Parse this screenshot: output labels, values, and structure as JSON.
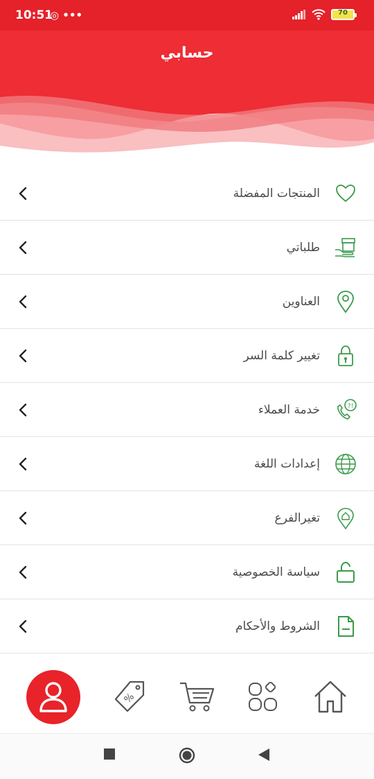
{
  "status_bar": {
    "time": "10:51",
    "left_icons": "◎ •••",
    "battery": "70"
  },
  "header": {
    "title": "حسابي",
    "accent_color": "#e8232a"
  },
  "menu": {
    "items": [
      {
        "label": "المنتجات المفضلة",
        "icon": "heart-icon"
      },
      {
        "label": "طلباتي",
        "icon": "box-hand-icon"
      },
      {
        "label": "العناوين",
        "icon": "location-pin-icon"
      },
      {
        "label": "تغيير كلمة السر",
        "icon": "lock-icon"
      },
      {
        "label": "خدمة العملاء",
        "icon": "phone-support-icon"
      },
      {
        "label": "إعدادات اللغة",
        "icon": "globe-icon"
      },
      {
        "label": "تغيرالفرع",
        "icon": "home-pin-icon"
      },
      {
        "label": "سياسة الخصوصية",
        "icon": "unlock-icon"
      },
      {
        "label": "الشروط والأحكام",
        "icon": "document-icon"
      }
    ],
    "icon_color": "#3a9a4a"
  },
  "bottom_nav": {
    "items": [
      "home-icon",
      "categories-icon",
      "cart-icon",
      "offers-tag-icon",
      "account-icon"
    ],
    "active": "account-icon"
  },
  "system_nav": [
    "recents-square-icon",
    "home-circle-icon",
    "back-triangle-icon"
  ]
}
